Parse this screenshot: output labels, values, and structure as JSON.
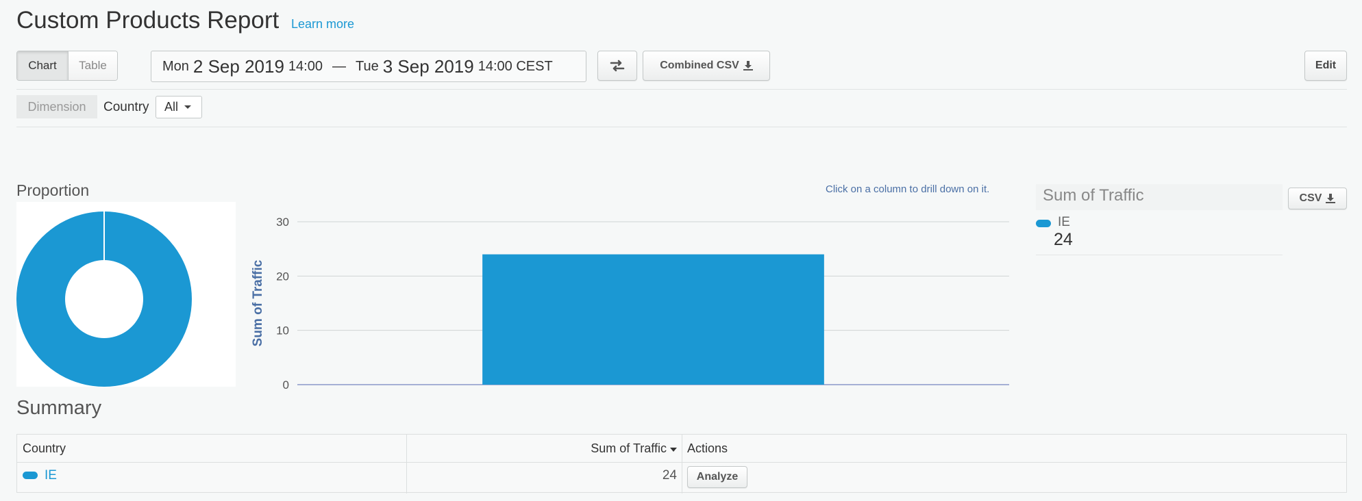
{
  "header": {
    "title": "Custom Products Report",
    "learn_more": "Learn more"
  },
  "toolbar": {
    "view_tabs": [
      {
        "label": "Chart",
        "active": true
      },
      {
        "label": "Table",
        "active": false
      }
    ],
    "date_range": {
      "start_day": "Mon",
      "start_date": "2 Sep 2019",
      "start_time": "14:00",
      "separator": "—",
      "end_day": "Tue",
      "end_date": "3 Sep 2019",
      "end_time": "14:00 CEST"
    },
    "swap_icon": "swap-arrows-icon",
    "combined_csv_label": "Combined CSV",
    "edit_label": "Edit"
  },
  "filters": {
    "dimension_label": "Dimension",
    "country_label": "Country",
    "country_value": "All"
  },
  "proportion": {
    "title": "Proportion"
  },
  "chart_data": {
    "type": "bar",
    "hint": "Click on a column to drill down on it.",
    "categories": [
      "IE"
    ],
    "values": [
      24
    ],
    "ylabel": "Sum of Traffic",
    "ylim": [
      0,
      30
    ],
    "yticks": [
      0,
      10,
      20,
      30
    ],
    "grid": true,
    "color": "#1b98d3"
  },
  "pie_data": {
    "type": "pie",
    "slices": [
      {
        "label": "IE",
        "value": 24
      }
    ],
    "color": "#1b98d3"
  },
  "legend_panel": {
    "title": "Sum of Traffic",
    "csv_label": "CSV",
    "items": [
      {
        "label": "IE",
        "value": "24"
      }
    ]
  },
  "summary": {
    "title": "Summary",
    "columns": [
      "Country",
      "Sum of Traffic",
      "Actions"
    ],
    "rows": [
      {
        "country": "IE",
        "traffic": "24",
        "action": "Analyze"
      }
    ]
  },
  "colors": {
    "accent": "#1b98d3",
    "link": "#1b98d3",
    "axis_title": "#4a6fa5"
  }
}
